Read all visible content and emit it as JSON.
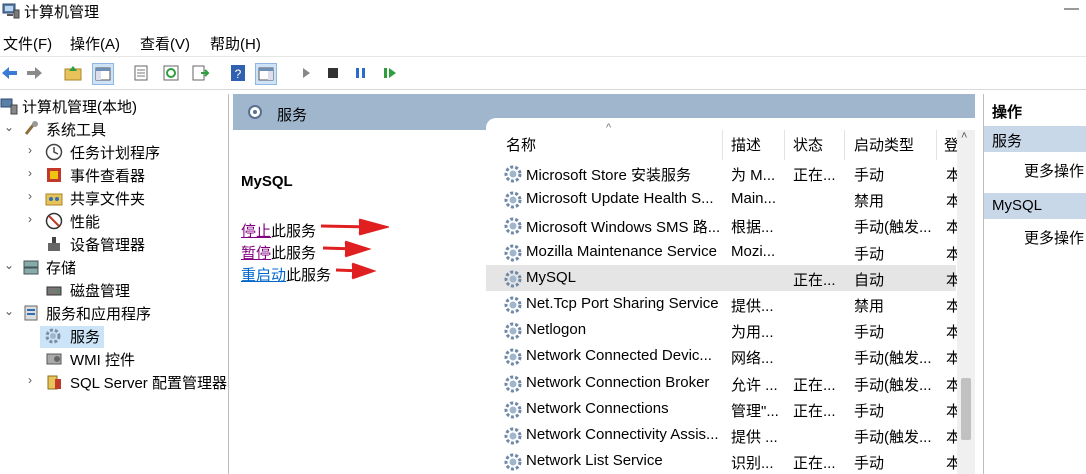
{
  "window": {
    "title": "计算机管理",
    "minimize_glyph": "—"
  },
  "menu": [
    "文件(F)",
    "操作(A)",
    "查看(V)",
    "帮助(H)"
  ],
  "toolbar_icons": [
    "back-arrow-icon",
    "forward-arrow-icon",
    "up-folder-icon",
    "show-hide-tree-icon",
    "properties-icon",
    "refresh-icon",
    "export-list-icon",
    "help-icon",
    "show-hide-action-pane-icon",
    "start-service-icon",
    "stop-service-icon",
    "pause-service-icon",
    "resume-service-icon"
  ],
  "tree": {
    "root": "计算机管理(本地)",
    "system_tools": "系统工具",
    "task_scheduler": "任务计划程序",
    "event_viewer": "事件查看器",
    "shared_folders": "共享文件夹",
    "performance": "性能",
    "device_manager": "设备管理器",
    "storage": "存储",
    "disk_management": "磁盘管理",
    "services_apps": "服务和应用程序",
    "services": "服务",
    "wmi": "WMI 控件",
    "sql_config": "SQL Server 配置管理器"
  },
  "main": {
    "header": "服务",
    "selected_service": "MySQL",
    "actions": [
      {
        "link": "停止",
        "rest": "此服务"
      },
      {
        "link": "暂停",
        "rest": "此服务"
      },
      {
        "link": "重启动",
        "rest": "此服务"
      }
    ],
    "columns": [
      "名称",
      "描述",
      "状态",
      "启动类型",
      "登"
    ],
    "sort_glyph": "^",
    "rows": [
      {
        "name": "Microsoft Store 安装服务",
        "desc": "为 M...",
        "status": "正在...",
        "startup": "手动",
        "more": "本"
      },
      {
        "name": "Microsoft Update Health S...",
        "desc": "Main...",
        "status": "",
        "startup": "禁用",
        "more": "本"
      },
      {
        "name": "Microsoft Windows SMS 路...",
        "desc": "根据...",
        "status": "",
        "startup": "手动(触发...",
        "more": "本"
      },
      {
        "name": "Mozilla Maintenance Service",
        "desc": "Mozi...",
        "status": "",
        "startup": "手动",
        "more": "本"
      },
      {
        "name": "MySQL",
        "desc": "",
        "status": "正在...",
        "startup": "自动",
        "more": "本"
      },
      {
        "name": "Net.Tcp Port Sharing Service",
        "desc": "提供...",
        "status": "",
        "startup": "禁用",
        "more": "本"
      },
      {
        "name": "Netlogon",
        "desc": "为用...",
        "status": "",
        "startup": "手动",
        "more": "本"
      },
      {
        "name": "Network Connected Devic...",
        "desc": "网络...",
        "status": "",
        "startup": "手动(触发...",
        "more": "本"
      },
      {
        "name": "Network Connection Broker",
        "desc": "允许 ...",
        "status": "正在...",
        "startup": "手动(触发...",
        "more": "本"
      },
      {
        "name": "Network Connections",
        "desc": "管理\"...",
        "status": "正在...",
        "startup": "手动",
        "more": "本"
      },
      {
        "name": "Network Connectivity Assis...",
        "desc": "提供 ...",
        "status": "",
        "startup": "手动(触发...",
        "more": "本"
      },
      {
        "name": "Network List Service",
        "desc": "识别...",
        "status": "正在...",
        "startup": "手动",
        "more": "本"
      }
    ]
  },
  "action_pane": {
    "title": "操作",
    "section1": "服务",
    "more1": "更多操作",
    "section2": "MySQL",
    "more2": "更多操作"
  },
  "colors": {
    "header_blue": "#9fb6cd",
    "action_section": "#c9d8e8",
    "link": "#0066cc",
    "visited_link": "#800080",
    "arrow_red": "#e02020"
  }
}
